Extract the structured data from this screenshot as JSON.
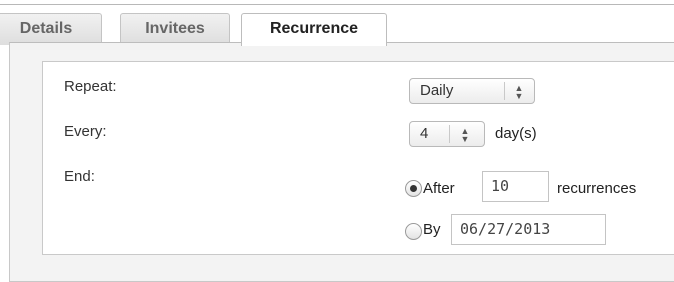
{
  "tabs": [
    {
      "label": "Details"
    },
    {
      "label": "Invitees"
    },
    {
      "label": "Recurrence"
    }
  ],
  "form": {
    "repeat_label": "Repeat:",
    "repeat_value": "Daily",
    "every_label": "Every:",
    "every_value": "4",
    "every_unit": "day(s)",
    "end_label": "End:",
    "end_after_label": "After",
    "end_after_value": "10",
    "end_after_unit": "recurrences",
    "end_by_label": "By",
    "end_by_value": "06/27/2013",
    "selected_end_option": "after"
  },
  "icons": {
    "select_arrows": "up-down-arrows-icon",
    "radio_selected": "radio-selected-icon",
    "radio_unselected": "radio-unselected-icon"
  }
}
